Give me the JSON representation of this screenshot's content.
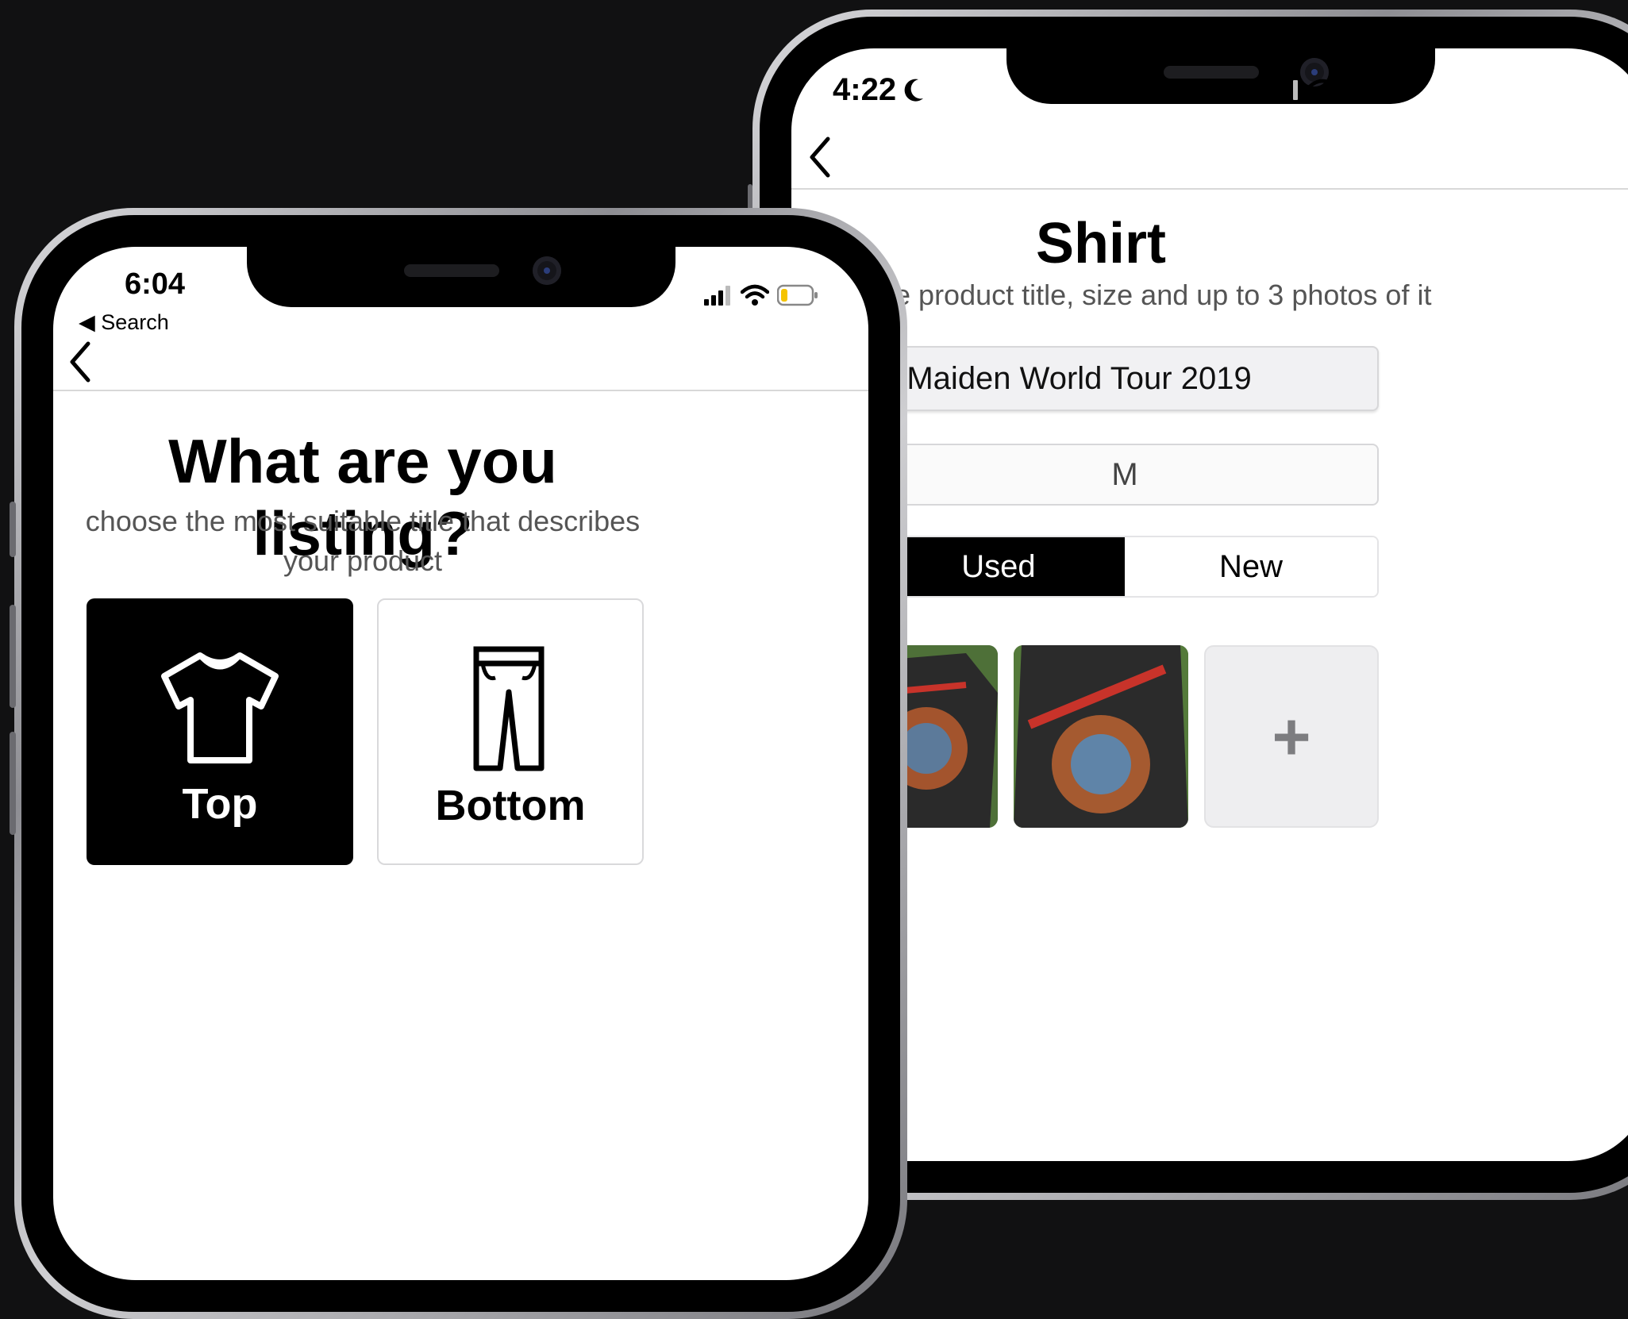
{
  "back_phone": {
    "status_time": "4:22",
    "moon_icon": "moon-icon",
    "page_title": "Shirt",
    "instruction": "the product title, size and up to 3 photos of it",
    "title_field_value": "n Maiden World Tour 2019",
    "size_field_value": "M",
    "condition_options": [
      "Used",
      "New"
    ],
    "condition_selected": "Used",
    "add_photo_symbol": "+"
  },
  "front_phone": {
    "status_time": "6:04",
    "back_link": "◀ Search",
    "page_title": "What are you listing?",
    "subtitle_line1": "choose the most suitable title that describes",
    "subtitle_line2": "your product",
    "categories": [
      {
        "label": "Top",
        "icon": "shirt-icon",
        "selected": true
      },
      {
        "label": "Bottom",
        "icon": "pants-icon",
        "selected": false
      }
    ]
  },
  "colors": {
    "background": "#111112",
    "selected_tile": "#000000",
    "accent_text": "#000000",
    "battery_low": "#f5c400"
  }
}
